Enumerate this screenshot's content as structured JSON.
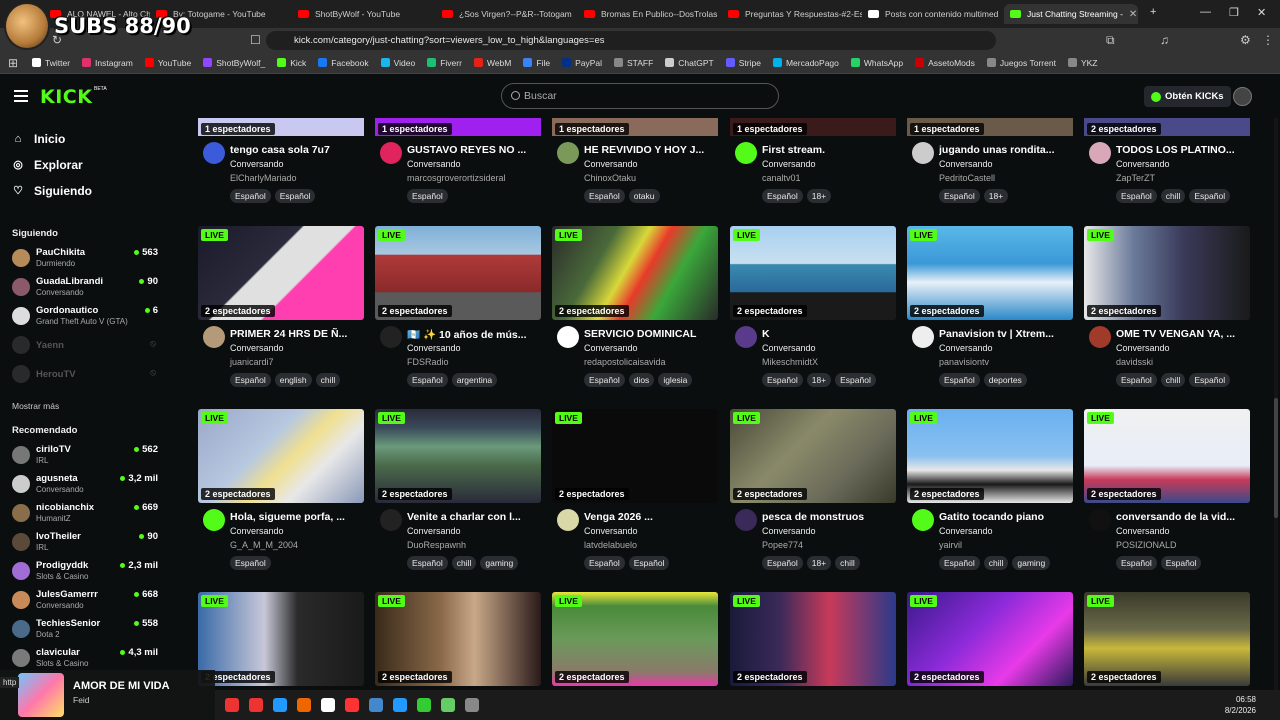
{
  "browser": {
    "overlay_subs": "SUBS 88/90",
    "tabs": [
      {
        "label": "ALO NAWEL - Alto Chas",
        "fav": "#f00"
      },
      {
        "label": "By: Totogame - YouTube",
        "fav": "#f00"
      },
      {
        "label": "ShotByWolf - YouTube",
        "fav": "#f00"
      },
      {
        "label": "¿Sos Virgen?--P&R--Totogam",
        "fav": "#f00"
      },
      {
        "label": "Bromas En Publico--DosTrolas",
        "fav": "#f00"
      },
      {
        "label": "Preguntas Y Respuestas-#2-Esp",
        "fav": "#f00"
      },
      {
        "label": "Posts con contenido multimed",
        "fav": "#fff"
      },
      {
        "label": "Just Chatting Streaming -",
        "fav": "#53fc18"
      }
    ],
    "url": "kick.com/category/just-chatting?sort=viewers_low_to_high&languages=es",
    "bookmarks": [
      {
        "label": "Twitter",
        "color": "#fff"
      },
      {
        "label": "Instagram",
        "color": "#e1306c"
      },
      {
        "label": "YouTube",
        "color": "#f00"
      },
      {
        "label": "ShotByWolf_",
        "color": "#9146ff"
      },
      {
        "label": "Kick",
        "color": "#53fc18"
      },
      {
        "label": "Facebook",
        "color": "#1877f2"
      },
      {
        "label": "Video",
        "color": "#1ab7ea"
      },
      {
        "label": "Fiverr",
        "color": "#1dbf73"
      },
      {
        "label": "WebM",
        "color": "#e62117"
      },
      {
        "label": "File",
        "color": "#3b82f6"
      },
      {
        "label": "PayPal",
        "color": "#003087"
      },
      {
        "label": "STAFF",
        "color": "#888"
      },
      {
        "label": "ChatGPT",
        "color": "#ccc"
      },
      {
        "label": "Stripe",
        "color": "#635bff"
      },
      {
        "label": "MercadoPago",
        "color": "#00b1ea"
      },
      {
        "label": "WhatsApp",
        "color": "#25d366"
      },
      {
        "label": "AssetoMods",
        "color": "#c00"
      },
      {
        "label": "Juegos Torrent",
        "color": "#888"
      },
      {
        "label": "YKZ",
        "color": "#888"
      }
    ]
  },
  "header": {
    "logo": "KICK",
    "logo_badge": "BETA",
    "search_placeholder": "Buscar",
    "get_kicks": "Obtén KICKs"
  },
  "sidebar": {
    "nav": [
      "Inicio",
      "Explorar",
      "Siguiendo"
    ],
    "following_title": "Siguiendo",
    "following": [
      {
        "name": "PauChikita",
        "category": "Durmiendo",
        "viewers": "563",
        "color": "#b58b5a"
      },
      {
        "name": "GuadaLibrandi",
        "category": "Conversando",
        "viewers": "90",
        "color": "#8a5a6a"
      },
      {
        "name": "Gordonautico",
        "category": "Grand Theft Auto V (GTA)",
        "viewers": "6",
        "color": "#ddd"
      },
      {
        "name": "Yaenn",
        "offline": true,
        "color": "#555"
      },
      {
        "name": "HerouTV",
        "offline": true,
        "color": "#555"
      }
    ],
    "show_more": "Mostrar más",
    "recommended_title": "Recomendado",
    "recommended": [
      {
        "name": "ciriloTV",
        "category": "IRL",
        "viewers": "562",
        "color": "#777"
      },
      {
        "name": "agusneta",
        "category": "Conversando",
        "viewers": "3,2 mil",
        "color": "#ccc"
      },
      {
        "name": "nicobianchix",
        "category": "HumanitZ",
        "viewers": "669",
        "color": "#8a6d4a"
      },
      {
        "name": "IvoTheiler",
        "category": "IRL",
        "viewers": "90",
        "color": "#5b4a3a"
      },
      {
        "name": "Prodigyddk",
        "category": "Slots & Casino",
        "viewers": "2,3 mil",
        "color": "#a06cd5"
      },
      {
        "name": "JulesGamerrr",
        "category": "Conversando",
        "viewers": "668",
        "color": "#c98a5a"
      },
      {
        "name": "TechiesSenior",
        "category": "Dota 2",
        "viewers": "558",
        "color": "#4a6a8a"
      },
      {
        "name": "clavicular",
        "category": "Slots & Casino",
        "viewers": "4,3 mil",
        "color": "#7a7a7a"
      }
    ]
  },
  "grid": {
    "live_label": "LIVE",
    "top_row": [
      {
        "viewers": "1 espectadores",
        "title": "tengo casa sola 7u7",
        "category": "Conversando",
        "user": "ElCharlyMariado",
        "tags": [
          "Español",
          "Español"
        ],
        "thumb": "#c8c8f0",
        "avatar": "#3b5bdb"
      },
      {
        "viewers": "1 espectadores",
        "title": "GUSTAVO REYES NO ...",
        "category": "Conversando",
        "user": "marcosgroverortizsideral",
        "tags": [
          "Español"
        ],
        "thumb": "#a020f0",
        "avatar": "#e0245e"
      },
      {
        "viewers": "1 espectadores",
        "title": "HE REVIVIDO Y HOY J...",
        "category": "Conversando",
        "user": "ChinoxOtaku",
        "tags": [
          "Español",
          "otaku"
        ],
        "thumb": "#8a6a5a",
        "avatar": "#7a9a5a"
      },
      {
        "viewers": "1 espectadores",
        "title": "First stream.",
        "category": "Conversando",
        "user": "canaltv01",
        "tags": [
          "Español",
          "18+"
        ],
        "thumb": "#3a1a1a",
        "avatar": "#53fc18"
      },
      {
        "viewers": "1 espectadores",
        "title": "jugando unas rondita...",
        "category": "Conversando",
        "user": "PedritoCastell",
        "tags": [
          "Español",
          "18+"
        ],
        "thumb": "#6a5a4a",
        "avatar": "#ccc"
      },
      {
        "viewers": "2 espectadores",
        "title": "TODOS LOS PLATINO...",
        "category": "Conversando",
        "user": "ZapTerZT",
        "tags": [
          "Español",
          "chill",
          "Español"
        ],
        "thumb": "#4a4a8a",
        "avatar": "#d8a8b8"
      }
    ],
    "rows": [
      [
        {
          "viewers": "2 espectadores",
          "title": "PRIMER 24 HRS DE Ñ...",
          "category": "Conversando",
          "user": "juanicardi7",
          "tags": [
            "Español",
            "english",
            "chill"
          ],
          "thumb": "linear-gradient(135deg,#1a1a2a 0%,#2a2a3a 40%,#e0e0e0 41%,#e0e0e0 60%,#ff3fb0 61%)",
          "avatar": "#b59a7a"
        },
        {
          "viewers": "2 espectadores",
          "title": "🇬🇹 ✨ 10 años de mús...",
          "category": "Conversando",
          "user": "FDSRadio",
          "tags": [
            "Español",
            "argentina"
          ],
          "thumb": "linear-gradient(180deg,#7fb0d8 0%,#a8c8e0 30%,#b03a3a 31%,#8a2a2a 70%,#5a5a5a 71%)",
          "avatar": "#222"
        },
        {
          "viewers": "2 espectadores",
          "title": "SERVICIO DOMINICAL",
          "category": "Conversando",
          "user": "redapostolicaisavida",
          "tags": [
            "Español",
            "dios",
            "iglesia"
          ],
          "thumb": "linear-gradient(120deg,#2a2a2a 0%,#4a6a3a 30%,#d8d83a 45%,#e83a2a 55%,#3aa83a 70%,#2a2a2a 100%)",
          "avatar": "#fff"
        },
        {
          "viewers": "2 espectadores",
          "title": "K",
          "category": "Conversando",
          "user": "MikeschmidtX",
          "tags": [
            "Español",
            "18+",
            "Español"
          ],
          "thumb": "linear-gradient(180deg,#a8d0f0 0%,#c8e0f0 40%,#3a8ab0 41%,#2a6a9a 70%,#1a1a1a 71%)",
          "avatar": "#5a3a8a"
        },
        {
          "viewers": "2 espectadores",
          "title": "Panavision tv | Xtrem...",
          "category": "Conversando",
          "user": "panavisiontv",
          "tags": [
            "Español",
            "deportes"
          ],
          "thumb": "linear-gradient(180deg,#5ab8e8 0%,#3a98d8 40%,#e8f0f8 60%,#2a88c8 100%)",
          "avatar": "#eee"
        },
        {
          "viewers": "2 espectadores",
          "title": "OME TV VENGAN YA, ...",
          "category": "Conversando",
          "user": "davidsski",
          "tags": [
            "Español",
            "chill",
            "Español"
          ],
          "thumb": "linear-gradient(90deg,#e8e8e8 0%,#6a7a9a 30%,#3a3a5a 60%,#1a1a1a 100%)",
          "avatar": "#a03a2a"
        }
      ],
      [
        {
          "viewers": "2 espectadores",
          "title": "Hola, sigueme porfa, ...",
          "category": "Conversando",
          "user": "G_A_M_M_2004",
          "tags": [
            "Español"
          ],
          "thumb": "linear-gradient(135deg,#9aa8c8 0%,#b8c8e0 40%,#f0e090 55%,#e8e8e8 70%,#8a98b8 100%)",
          "avatar": "#53fc18"
        },
        {
          "viewers": "2 espectadores",
          "title": "Venite a charlar con l...",
          "category": "Conversando",
          "user": "DuoRespawnh",
          "tags": [
            "Español",
            "chill",
            "gaming"
          ],
          "thumb": "linear-gradient(180deg,#2a2a3a 0%,#3a4a5a 20%,#6a9a7a 40%,#4a6a4a 60%,#2a2a3a 100%)",
          "avatar": "#222"
        },
        {
          "viewers": "2 espectadores",
          "title": "Venga 2026 ...",
          "category": "Conversando",
          "user": "latvdelabuelo",
          "tags": [
            "Español",
            "Español"
          ],
          "thumb": "#0a0a0a",
          "avatar": "#d8d8a8"
        },
        {
          "viewers": "2 espectadores",
          "title": "pesca de monstruos",
          "category": "Conversando",
          "user": "Popee774",
          "tags": [
            "Español",
            "18+",
            "chill"
          ],
          "thumb": "linear-gradient(135deg,#4a4a3a 0%,#8a8a6a 40%,#6a6a5a 70%,#3a3a2a 100%)",
          "avatar": "#3a2a5a"
        },
        {
          "viewers": "2 espectadores",
          "title": "Gatito tocando piano",
          "category": "Conversando",
          "user": "yairvil",
          "tags": [
            "Español",
            "chill",
            "gaming"
          ],
          "thumb": "linear-gradient(180deg,#6ab0f0 0%,#8ac0f0 50%,#e8e8e8 65%,#1a1a1a 80%,#e8e8e8 100%)",
          "avatar": "#53fc18"
        },
        {
          "viewers": "2 espectadores",
          "title": "conversando de la vid...",
          "category": "Conversando",
          "user": "POSIZIONALD",
          "tags": [
            "Español",
            "Español"
          ],
          "thumb": "linear-gradient(180deg,#f0f0f0 0%,#e8eef8 60%,#c83a5a 75%,#3a4a8a 100%)",
          "avatar": "#111"
        }
      ],
      [
        {
          "viewers": "2 espectadores",
          "thumb": "linear-gradient(90deg,#3a6aa8 0%,#c8c8d8 40%,#2a2a2a 60%,#1a1a1a 100%)"
        },
        {
          "viewers": "2 espectadores",
          "thumb": "linear-gradient(90deg,#3a2a1a 0%,#8a6a4a 40%,#c8a888 60%,#2a1a1a 100%)"
        },
        {
          "viewers": "2 espectadores",
          "thumb": "linear-gradient(180deg,#e8e83a 0%,#4a8a3a 15%,#6a9a5a 50%,#8a7a6a 85%,#e83aa8 100%)"
        },
        {
          "viewers": "2 espectadores",
          "thumb": "linear-gradient(90deg,#1a1a3a 0%,#3a2a5a 30%,#c83a5a 60%,#2a3a8a 100%)"
        },
        {
          "viewers": "2 espectadores",
          "thumb": "linear-gradient(135deg,#3a1a8a 0%,#8a2ad8 40%,#e83ae8 70%,#2a1a5a 100%)"
        },
        {
          "viewers": "2 espectadores",
          "thumb": "linear-gradient(180deg,#3a3a2a 0%,#6a6a4a 40%,#c8b83a 60%,#3a3a3a 100%)"
        }
      ]
    ]
  },
  "media": {
    "title": "AMOR DE MI VIDA",
    "artist": "Feid",
    "url_hint": "http"
  },
  "taskbar": {
    "time": "06:58",
    "date": "8/2/2026"
  }
}
